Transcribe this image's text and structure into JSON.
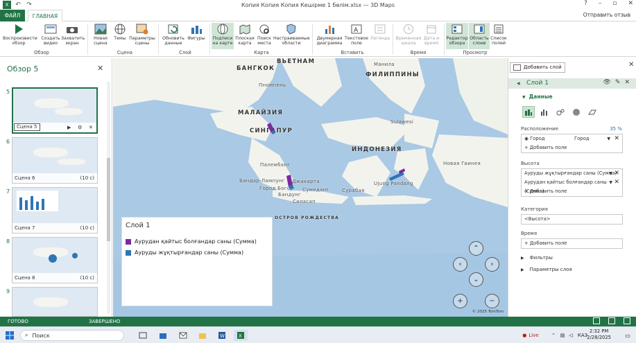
{
  "window": {
    "title": "Копия Копия Копия Кешірме 1 бөлім.xlsx — 3D Maps",
    "tab_file": "ФАЙЛ",
    "tab_home": "ГЛАВНАЯ",
    "feedback": "Отправить отзыв"
  },
  "ribbon": {
    "buttons": {
      "play": "Воспроизвести обзор",
      "create_video": "Создать видео",
      "capture": "Захватить экран",
      "new_scene": "Новая сцена",
      "themes": "Темы",
      "scene_options": "Параметры сцены",
      "refresh": "Обновить данные",
      "shapes": "Фигуры",
      "map_labels": "Подписи на карте",
      "flat_map": "Плоская карта",
      "find_location": "Поиск места",
      "custom_regions": "Настраиваемые области",
      "chart_2d": "Двумерная диаграмма",
      "text_box": "Текстовое поле",
      "legend": "Легенда",
      "timeline": "Временная шкала",
      "date_time": "Дата и время",
      "tour_editor": "Редактор обзора",
      "layer_pane": "Область слоев",
      "field_list": "Список полей"
    },
    "groups": {
      "tour": "Обзор",
      "scene": "Сцена",
      "layer": "Слой",
      "map": "Карта",
      "insert": "Вставить",
      "time": "Время",
      "view": "Просмотр"
    }
  },
  "tour_pane": {
    "title": "Обзор 5",
    "scenes": [
      {
        "num": "5",
        "label": "Сцена 5",
        "duration": ""
      },
      {
        "num": "6",
        "label": "Сцена 6",
        "duration": "(10 с)"
      },
      {
        "num": "7",
        "label": "Сцена 7",
        "duration": "(10 с)"
      },
      {
        "num": "8",
        "label": "Сцена 8",
        "duration": "(10 с)"
      },
      {
        "num": "9",
        "label": "",
        "duration": ""
      }
    ]
  },
  "map": {
    "labels": {
      "vietnam": "ВЬЕТНАМ",
      "bangkok": "БАНГКОК",
      "phnom_penh": "Пномпень",
      "philippines": "ФИЛИППИНЫ",
      "manila": "Манила",
      "malaysia": "МАЛАЙЗИЯ",
      "singapore": "СИНГАПУР",
      "indonesia": "ИНДОНЕЗИЯ",
      "palembang": "Палембанг",
      "bandar_lampung": "Бандар-Лампунг",
      "jakarta": "Джакарта",
      "bogor": "Город Богор",
      "bandung": "Бандунг",
      "sumedang": "Сумеданг",
      "surabaya": "Сурабая",
      "cilacap": "Силасап",
      "ujung_pandang": "Ujung Pandang",
      "christmas": "ОСТРОВ РОЖДЕСТВА",
      "sulawesi": "Sulawesi",
      "new_guinea": "Новая Гвинея"
    },
    "copyright": "© 2025 TomTom",
    "legend": {
      "title": "Слой 1",
      "items": [
        {
          "label": "Аурудан қайтыс болғандар саны (Сумма)",
          "color": "#7a2a9e"
        },
        {
          "label": "Ауруды жұқтырғандар саны (Сумма)",
          "color": "#2e75b6"
        }
      ]
    }
  },
  "layer_pane": {
    "add_layer": "Добавить слой",
    "layer_name": "Слой 1",
    "data_section": "Данные",
    "location_label": "Расположение",
    "location_pct": "35 %",
    "location_field": "Город",
    "location_type": "Город",
    "add_field": "Добавить поле",
    "height_label": "Высота",
    "height_fields": [
      "Ауруды жұқтырғандар саны (Сумма)",
      "Аурудан қайтыс болғандар саны (Сумма)"
    ],
    "category_label": "Категория",
    "category_value": "<Высота>",
    "time_label": "Время",
    "filters": "Фильтры",
    "layer_options": "Параметры слоя"
  },
  "status": {
    "ready": "ГОТОВО",
    "done": "ЗАВЕРШЕНО"
  },
  "taskbar": {
    "search": "Поиск",
    "live": "Live",
    "lang": "КАЗ",
    "time": "2:32 PM",
    "date": "2/28/2025"
  }
}
